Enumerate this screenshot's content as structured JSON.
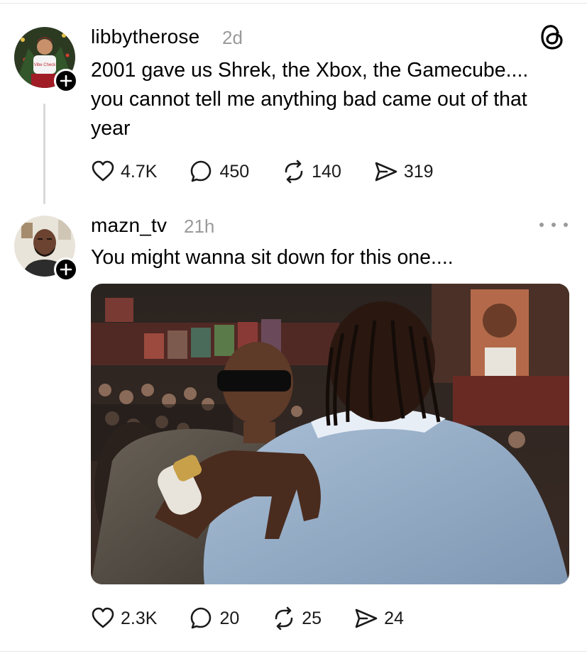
{
  "posts": [
    {
      "username": "libbytherose",
      "time": "2d",
      "text_lines": [
        "2001 gave us Shrek, the Xbox, the Gamecube....",
        "you cannot tell me anything bad came out of that",
        "year"
      ],
      "avatar_shirt_text": "Vibe Check",
      "stats": {
        "likes": "4.7K",
        "replies": "450",
        "reposts": "140",
        "shares": "319"
      }
    },
    {
      "username": "mazn_tv",
      "time": "21h",
      "text": "You might wanna sit down for this one....",
      "stats": {
        "likes": "2.3K",
        "replies": "20",
        "reposts": "25",
        "shares": "24"
      }
    }
  ],
  "icons": {
    "header": "threads-logo-icon",
    "more": "more-options-icon",
    "follow": "plus-icon",
    "actions": [
      "heart-icon",
      "comment-icon",
      "repost-icon",
      "share-icon"
    ]
  },
  "colors": {
    "muted": "#9a9a9a",
    "thread_line": "#d9d9d9",
    "plus_badge": "#000000"
  }
}
